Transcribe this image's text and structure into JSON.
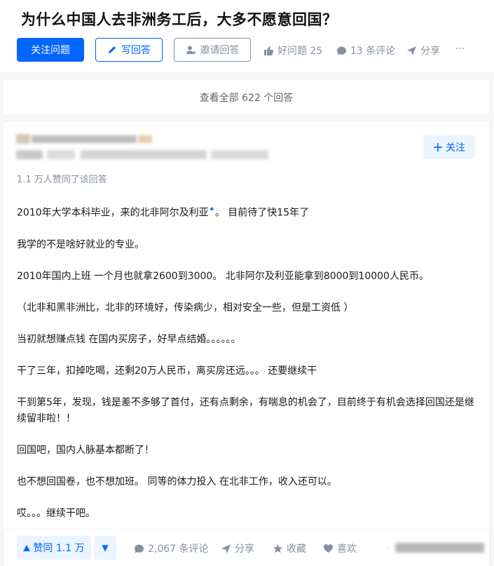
{
  "question": {
    "title": "为什么中国人去非洲务工后，大多不愿意回国？",
    "follow_label": "关注问题",
    "write_label": "写回答",
    "invite_label": "邀请回答",
    "good_question_label": "好问题 25",
    "comments_label": "13 条评论",
    "share_label": "分享",
    "more_label": "···"
  },
  "view_all_label": "查看全部 622 个回答",
  "answer": {
    "follow_author_label": "关注",
    "upvote_summary": "1.1 万人赞同了该回答",
    "paragraphs": [
      "2010年大学本科毕业，来的北非阿尔及利亚",
      "我学的不是啥好就业的专业。",
      "2010年国内上班 一个月也就拿2600到3000。 北非阿尔及利亚能拿到8000到10000人民币。",
      "（北非和黑非洲比，北非的环境好，传染病少，相对安全一些，但是工资低 ）",
      "当初就想赚点钱 在国内买房子，好早点结婚。。。。。。",
      "干了三年，扣掉吃喝，还剩20万人民币，离买房还远。。。 还要继续干",
      "干到第5年，发现，钱是差不多够了首付，还有点剩余，有喘息的机会了，目前终于有机会选择回国还是继续留非啦！！",
      "回国吧，国内人脉基本都断了！",
      "也不想回国卷，也不想加班。 同等的体力投入 在北非工作，收入还可以。",
      "哎。。。继续干吧。"
    ],
    "paragraph_0_tail": "。 目前待了快15年了",
    "link_glyph": "✦"
  },
  "bottom_bar": {
    "vote_up_label": "赞同 1.1 万",
    "vote_down_glyph": "▼",
    "comments_label": "2,067 条评论",
    "share_label": "分享",
    "favorite_label": "收藏",
    "like_label": "喜欢"
  },
  "colors": {
    "primary": "#0066ff",
    "primary_light": "#ebf5ff",
    "muted": "#8590a6",
    "background": "#f6f6f6"
  }
}
